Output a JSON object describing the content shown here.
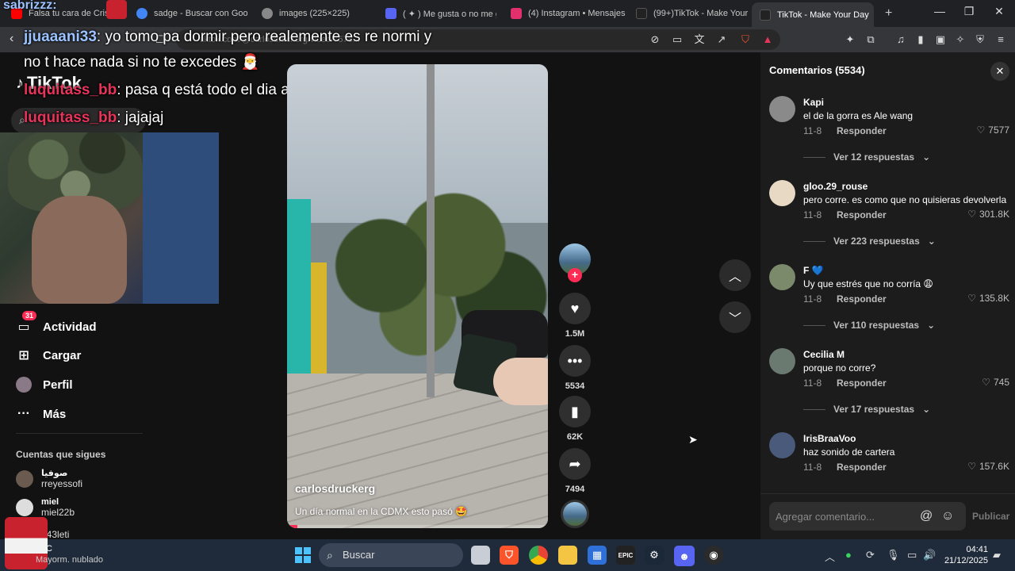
{
  "browser": {
    "tabs": [
      {
        "title": "Falsa tu cara de Cristo ...",
        "favicon": "youtube-icon",
        "color": "#ff0000"
      },
      {
        "title": "sadge - Buscar con Google",
        "favicon": "google-icon",
        "color": "#4285f4"
      },
      {
        "title": "images (225×225)",
        "favicon": "globe-icon",
        "color": "#888888"
      },
      {
        "title": "( ✦ ) Me gusta o no me gu...",
        "favicon": "discord-icon",
        "color": "#5865f2"
      },
      {
        "title": "(4) Instagram • Mensajes",
        "favicon": "instagram-icon",
        "color": "#e1306c"
      },
      {
        "title": "(99+)TikTok - Make Your D...",
        "favicon": "tiktok-icon",
        "color": "#222222"
      },
      {
        "title": "TikTok - Make Your Day",
        "favicon": "tiktok-icon",
        "color": "#222222",
        "active": true
      }
    ],
    "new_tab": "+",
    "url": "tiktok.com/@carlosdruckerg/video/7578..."
  },
  "stream_overlay": {
    "top_user": "sabrizzz:",
    "chat": [
      {
        "user": "jjuaaani33",
        "text": ": yo tomo pa dormir pero realemente es re normi y"
      },
      {
        "user": "",
        "text": "no t hace nada si no te excedes 🎅"
      },
      {
        "user": "luquitass_bb",
        "text": ": pasa q está todo el dia al pedo"
      },
      {
        "user": "luquitass_bb",
        "text": ": jajajaj"
      }
    ]
  },
  "tiktok": {
    "logo": "TikTok",
    "nav": {
      "activity": "Actividad",
      "activity_badge": "31",
      "upload": "Cargar",
      "profile": "Perfil",
      "more": "Más"
    },
    "following_title": "Cuentas que sigues",
    "following": [
      {
        "name": "صوفيا",
        "user": "rreyessofi"
      },
      {
        "name": "miel",
        "user": "miel22b"
      },
      {
        "name": "",
        "user": "143leti"
      }
    ],
    "video": {
      "username": "carlosdruckerg",
      "caption": "Un día normal en la CDMX esto pasó 🤩",
      "progress": 0.04
    },
    "actions": {
      "likes": "1.5M",
      "comments": "5534",
      "saves": "62K",
      "shares": "7494"
    },
    "comments_panel": {
      "title": "Comentarios (5534)",
      "reply_label": "Responder",
      "input_placeholder": "Agregar comentario...",
      "post_label": "Publicar",
      "comments": [
        {
          "user": "Kapi",
          "text": "el de la gorra es Ale wang",
          "date": "11-8",
          "likes": "7577",
          "more": "Ver 12 respuestas",
          "avatar_color": "#8a8a8a"
        },
        {
          "user": "gloo.29_rouse",
          "text": "pero corre. es como que no quisieras devolverla",
          "date": "11-8",
          "likes": "301.8K",
          "more": "Ver 223 respuestas",
          "avatar_color": "#e8d9c4"
        },
        {
          "user": "F 💙",
          "text": "Uy que estrés que no corría 😩",
          "date": "11-8",
          "likes": "135.8K",
          "more": "Ver 110 respuestas",
          "avatar_color": "#7b8a6a"
        },
        {
          "user": "Cecilia M",
          "text": "porque no corre?",
          "date": "11-8",
          "likes": "745",
          "more": "Ver 17 respuestas",
          "avatar_color": "#6b7a70"
        },
        {
          "user": "IrisBraaVoo",
          "text": "haz sonido de cartera",
          "date": "11-8",
          "likes": "157.6K",
          "more": "",
          "avatar_color": "#4a5a7a"
        }
      ]
    }
  },
  "taskbar": {
    "weather_temp": "C",
    "weather_desc": "Mayorm. nublado",
    "search_placeholder": "Buscar",
    "time": "04:41",
    "date": "21/12/2025"
  }
}
